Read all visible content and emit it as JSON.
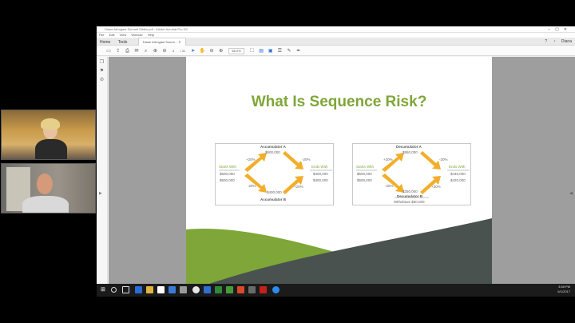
{
  "window": {
    "title": "Diane Arbogast Summit Slides.pdf - Adobe Acrobat Pro DC",
    "menu": [
      "File",
      "Edit",
      "View",
      "Window",
      "Help"
    ]
  },
  "tabs": {
    "home": "Home",
    "tools": "Tools",
    "document": "Diane Arbogast Summ...",
    "user": "Diana"
  },
  "toolbar": {
    "page_current": "4",
    "page_total": "/ 11",
    "zoom": "66.0%"
  },
  "slide": {
    "title": "What Is Sequence Risk?",
    "accumulator": {
      "top_label": "Accumulator A",
      "top_value": "$600,000",
      "starts_label": "Starts With",
      "starts_values": [
        "$500,000",
        "$500,000"
      ],
      "ends_label": "Ends With",
      "ends_values": [
        "$400,000",
        "$400,000"
      ],
      "bottom_value": "$400,000",
      "bottom_label": "Accumulator B",
      "pcts": [
        "+20%",
        "-20%",
        "-20%",
        "+20%"
      ]
    },
    "decumulator": {
      "top_label": "Decumulator A",
      "top_value": "$550,000",
      "starts_label": "Starts With",
      "starts_values": [
        "$500,000",
        "$500,000"
      ],
      "ends_label": "Ends With",
      "ends_values": [
        "$440,000",
        "$420,000"
      ],
      "bottom_value": "$350,000",
      "bottom_label": "Decumulator B",
      "withdraws": "Withdraws $50,000",
      "pcts": [
        "+20%",
        "-20%",
        "-20%",
        "+20%"
      ]
    }
  },
  "taskbar": {
    "time": "3:58 PM",
    "date": "6/1/2017"
  },
  "colors": {
    "accent_green": "#7fa638",
    "arrow_orange": "#f2ae2a",
    "dark_band": "#4a524f"
  }
}
